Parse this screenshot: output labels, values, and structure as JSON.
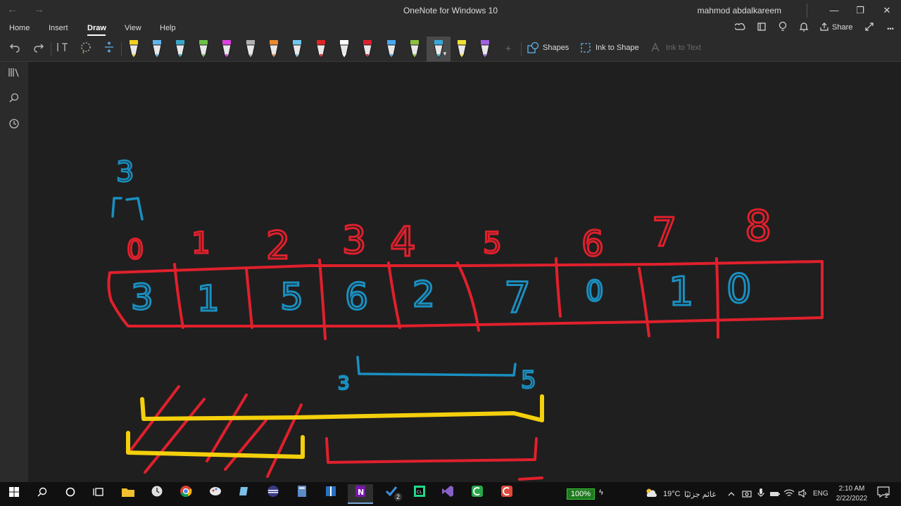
{
  "window": {
    "title": "OneNote for Windows 10",
    "user": "mahmod abdalkareem",
    "back_glyph": "←",
    "forward_glyph": "→",
    "minimize_glyph": "—",
    "restore_glyph": "❐",
    "close_glyph": "✕"
  },
  "menu": {
    "tabs": [
      {
        "label": "Home"
      },
      {
        "label": "Insert"
      },
      {
        "label": "Draw",
        "active": true
      },
      {
        "label": "View"
      },
      {
        "label": "Help"
      }
    ],
    "share_label": "Share",
    "more_glyph": "•••"
  },
  "toolbar": {
    "shapes_label": "Shapes",
    "ink_to_shape_label": "Ink to Shape",
    "ink_to_text_label": "Ink to Text",
    "add_glyph": "+",
    "pens": [
      {
        "color": "#f0d020"
      },
      {
        "color": "#5fb4ec"
      },
      {
        "color": "#3aa6c8"
      },
      {
        "color": "#6cc04a"
      },
      {
        "color": "#e040e0"
      },
      {
        "color": "#b0b0b0"
      },
      {
        "color": "#e88a30"
      },
      {
        "color": "#70c8f0"
      },
      {
        "color": "#e02424"
      },
      {
        "color": "#ffffff"
      },
      {
        "color": "#e02030"
      },
      {
        "color": "#48a8f0"
      },
      {
        "color": "#8cc040"
      },
      {
        "color": "#38a8d8"
      },
      {
        "color": "#f0e030"
      },
      {
        "color": "#a060e0"
      }
    ]
  },
  "drawing": {
    "index_labels": [
      "0",
      "1",
      "2",
      "3",
      "4",
      "5",
      "6",
      "7",
      "8"
    ],
    "cell_values": [
      "3",
      "1",
      "5",
      "6",
      "2",
      "7",
      "0",
      "1",
      "0"
    ],
    "top_value": "3",
    "range_start_label": "3",
    "range_end_label": "5",
    "ink_red": "#e0202c",
    "ink_blue": "#1a8fc0",
    "ink_yellow": "#f4d00c"
  },
  "taskbar": {
    "battery": "100%",
    "temperature": "19°C",
    "weather": "غائم جزئيًا",
    "language": "ENG",
    "time": "2:10 AM",
    "date": "2/22/2022",
    "notification_count": "2",
    "badge_count": "2"
  }
}
